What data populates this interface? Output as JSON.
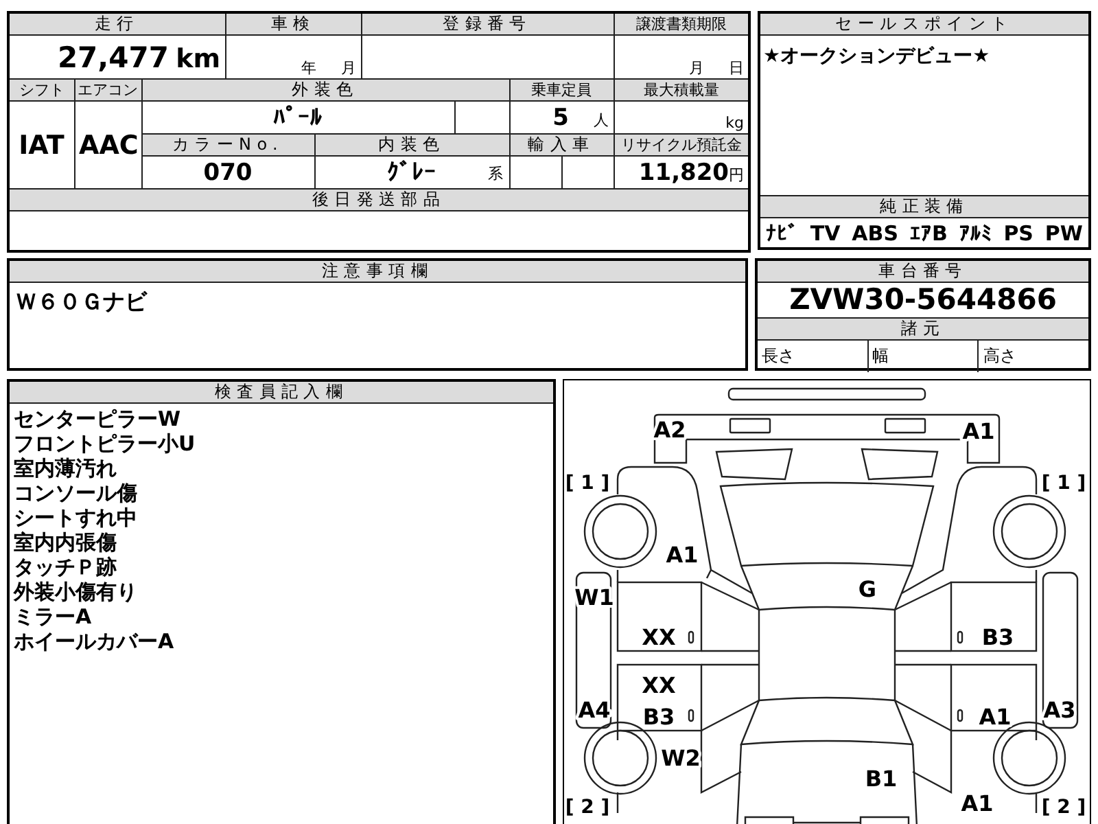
{
  "vehicle_info": {
    "mileage_label": "走行",
    "mileage": "27,477",
    "mileage_unit": "km",
    "inspection_label": "車検",
    "inspection_year_unit": "年",
    "inspection_month_unit": "月",
    "registration_label": "登録番号",
    "transfer_deadline_label": "譲渡書類期限",
    "transfer_month_unit": "月",
    "transfer_day_unit": "日",
    "shift_label": "シフト",
    "shift": "IAT",
    "ac_label": "エアコン",
    "ac": "AAC",
    "exterior_color_label": "外装色",
    "exterior_color": "ﾊﾟｰﾙ",
    "capacity_label": "乗車定員",
    "capacity": "5",
    "capacity_unit": "人",
    "max_load_label": "最大積載量",
    "max_load_unit": "kg",
    "color_no_label": "カラーNo.",
    "color_no": "070",
    "interior_color_label": "内装色",
    "interior_color": "ｸﾞﾚｰ",
    "interior_color_suffix": "系",
    "import_label": "輸入車",
    "recycle_label": "リサイクル預託金",
    "recycle_fee": "11,820",
    "recycle_unit": "円",
    "later_parts_label": "後日発送部品"
  },
  "sale_points": {
    "label": "セールスポイント",
    "text": "★オークションデビュー★"
  },
  "equipment": {
    "label": "純正装備",
    "items": [
      "ﾅﾋﾞ",
      "TV",
      "ABS",
      "ｴｱB",
      "ｱﾙﾐ",
      "PS",
      "PW"
    ]
  },
  "notes": {
    "label": "注意事項欄",
    "text": "Ｗ６０Ｇナビ"
  },
  "chassis": {
    "label": "車台番号",
    "number": "ZVW30-5644866",
    "specs_label": "諸元",
    "specs": [
      "長さ",
      "幅",
      "高さ"
    ]
  },
  "inspector_notes": {
    "label": "検査員記入欄",
    "lines": [
      "センターピラーW",
      "フロントピラー小U",
      "室内薄汚れ",
      "コンソール傷",
      "シートすれ中",
      "室内内張傷",
      "タッチＰ跡",
      "外装小傷有り",
      "ミラーA",
      "ホイールカバーA"
    ]
  },
  "diagram": {
    "marks": [
      "A2",
      "A1",
      "A1",
      "G",
      "W1",
      "XX",
      "B3",
      "XX",
      "A4",
      "B3",
      "A1",
      "A3",
      "W2",
      "B1",
      "A1"
    ],
    "wheel_labels": [
      "[ 1 ]",
      "[ 1 ]",
      "[ 2 ]",
      "[ 2 ]"
    ]
  }
}
